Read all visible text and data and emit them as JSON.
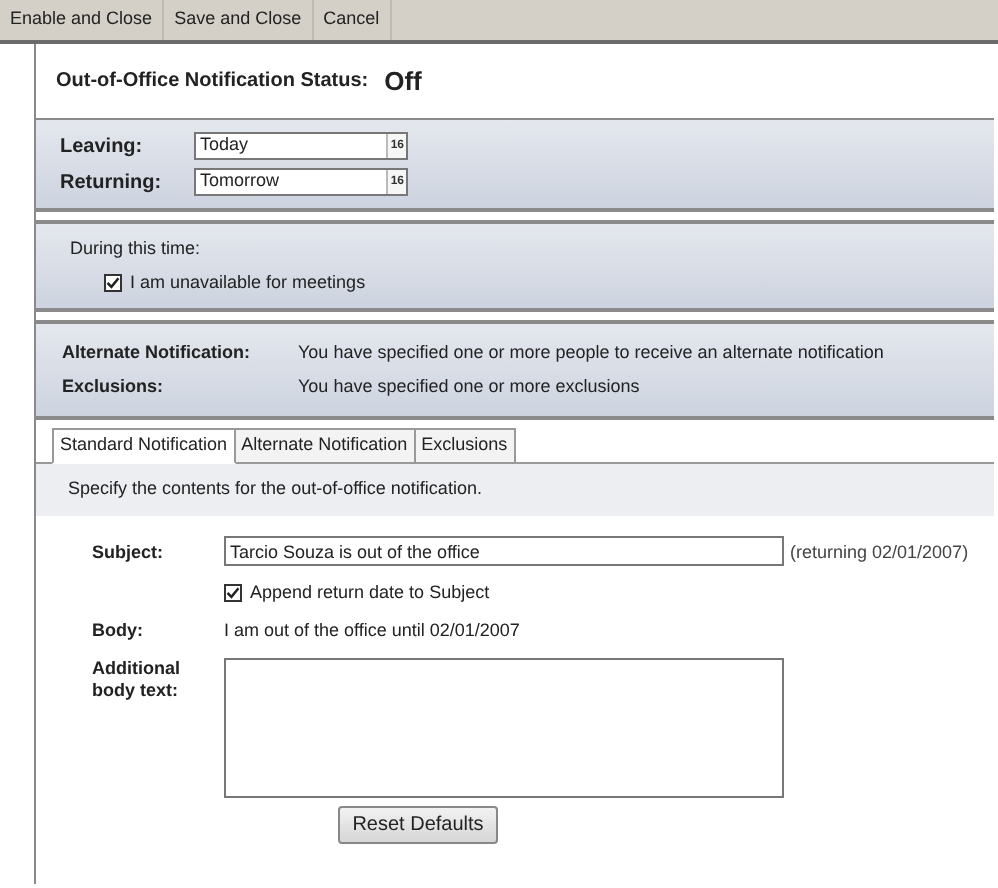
{
  "toolbar": [
    {
      "label": "Enable and Close"
    },
    {
      "label": "Save and Close"
    },
    {
      "label": "Cancel"
    }
  ],
  "status": {
    "label": "Out-of-Office Notification Status:",
    "value": "Off"
  },
  "dates": [
    {
      "label": "Leaving:",
      "value": "Today",
      "picker": "16"
    },
    {
      "label": "Returning:",
      "value": "Tomorrow",
      "picker": "16"
    }
  ],
  "during": {
    "label": "During this time:",
    "option": {
      "label": "I am unavailable for meetings",
      "checked": true
    }
  },
  "summary": [
    {
      "label": "Alternate Notification:",
      "text": "You have specified one or more people to receive an alternate notification"
    },
    {
      "label": "Exclusions:",
      "text": "You have specified one or more exclusions"
    }
  ],
  "tabs": [
    {
      "label": "Standard Notification",
      "selected": true
    },
    {
      "label": "Alternate Notification",
      "selected": false
    },
    {
      "label": "Exclusions",
      "selected": false
    }
  ],
  "instructions": "Specify the contents for the out-of-office notification.",
  "subject": {
    "label": "Subject:",
    "value": "Tarcio Souza is out of the office",
    "suffix": "(returning 02/01/2007)"
  },
  "append": {
    "label": "Append return date to Subject",
    "checked": true
  },
  "body": {
    "label": "Body:",
    "text": "I am out of the office until 02/01/2007"
  },
  "additional": {
    "label": "Additional body text:"
  },
  "reset_button": "Reset Defaults"
}
